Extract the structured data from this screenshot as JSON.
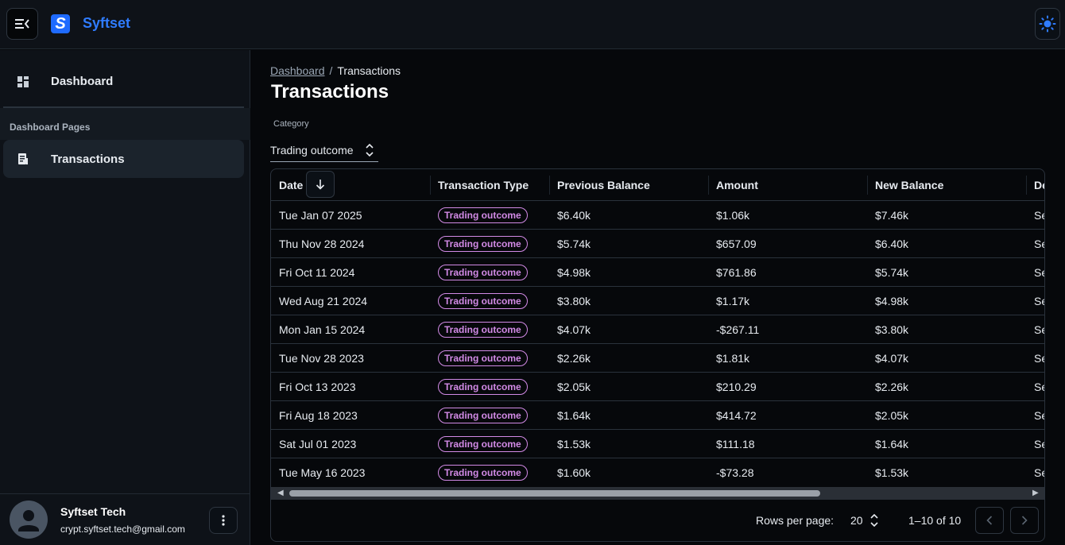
{
  "header": {
    "logo_letter": "S",
    "brand": "Syftset",
    "menu_icon": "menu-collapse-icon",
    "theme_icon": "sun-icon"
  },
  "sidebar": {
    "items": [
      {
        "label": "Dashboard",
        "icon": "grid-icon"
      },
      {
        "label": "Transactions",
        "icon": "receipt-icon",
        "active": true
      }
    ],
    "section_title": "Dashboard Pages",
    "user": {
      "name": "Syftset Tech",
      "email": "crypt.syftset.tech@gmail.com"
    }
  },
  "breadcrumb": {
    "link": "Dashboard",
    "separator": "/",
    "current": "Transactions"
  },
  "page_title": "Transactions",
  "filter": {
    "label": "Category",
    "value": "Trading outcome"
  },
  "table": {
    "columns": [
      "Date",
      "Transaction Type",
      "Previous Balance",
      "Amount",
      "New Balance",
      "De"
    ],
    "rows": [
      {
        "date": "Tue Jan 07 2025",
        "type": "Trading outcome",
        "prev": "$6.40k",
        "amount": "$1.06k",
        "new": "$7.46k",
        "desc": "Se"
      },
      {
        "date": "Thu Nov 28 2024",
        "type": "Trading outcome",
        "prev": "$5.74k",
        "amount": "$657.09",
        "new": "$6.40k",
        "desc": "Se"
      },
      {
        "date": "Fri Oct 11 2024",
        "type": "Trading outcome",
        "prev": "$4.98k",
        "amount": "$761.86",
        "new": "$5.74k",
        "desc": "Se"
      },
      {
        "date": "Wed Aug 21 2024",
        "type": "Trading outcome",
        "prev": "$3.80k",
        "amount": "$1.17k",
        "new": "$4.98k",
        "desc": "Se"
      },
      {
        "date": "Mon Jan 15 2024",
        "type": "Trading outcome",
        "prev": "$4.07k",
        "amount": "-$267.11",
        "new": "$3.80k",
        "desc": "Se"
      },
      {
        "date": "Tue Nov 28 2023",
        "type": "Trading outcome",
        "prev": "$2.26k",
        "amount": "$1.81k",
        "new": "$4.07k",
        "desc": "Se"
      },
      {
        "date": "Fri Oct 13 2023",
        "type": "Trading outcome",
        "prev": "$2.05k",
        "amount": "$210.29",
        "new": "$2.26k",
        "desc": "Se"
      },
      {
        "date": "Fri Aug 18 2023",
        "type": "Trading outcome",
        "prev": "$1.64k",
        "amount": "$414.72",
        "new": "$2.05k",
        "desc": "Se"
      },
      {
        "date": "Sat Jul 01 2023",
        "type": "Trading outcome",
        "prev": "$1.53k",
        "amount": "$111.18",
        "new": "$1.64k",
        "desc": "Se"
      },
      {
        "date": "Tue May 16 2023",
        "type": "Trading outcome",
        "prev": "$1.60k",
        "amount": "-$73.28",
        "new": "$1.53k",
        "desc": "Se"
      }
    ]
  },
  "pagination": {
    "rows_per_page_label": "Rows per page:",
    "rows_per_page": "20",
    "range": "1–10 of 10"
  },
  "colors": {
    "accent": "#2f7cff",
    "chip": "#d28ae6",
    "background": "#06080b",
    "sidebar": "#0e1218"
  }
}
